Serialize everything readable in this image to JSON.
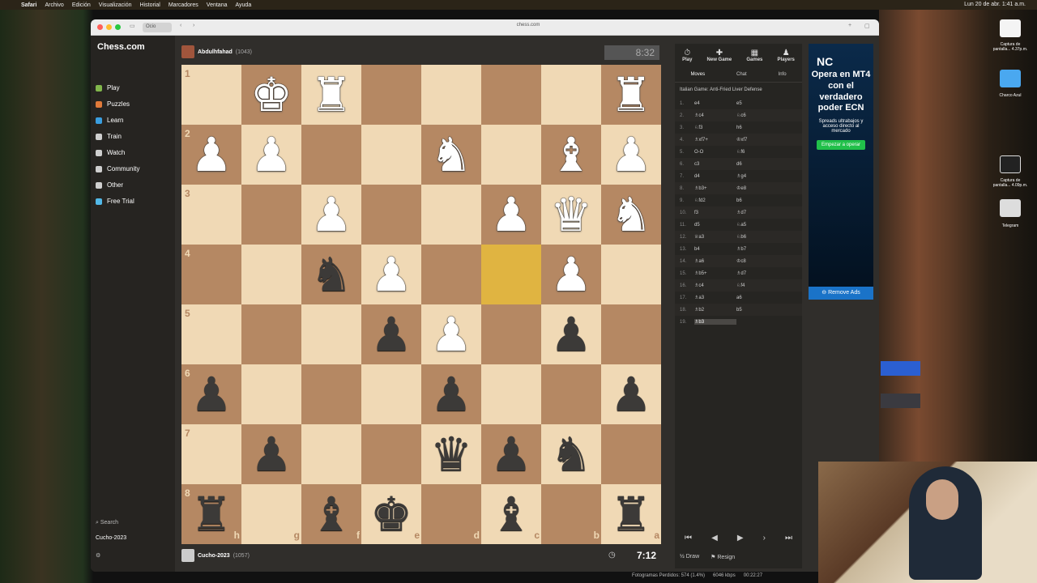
{
  "menubar": {
    "items": [
      "Safari",
      "Archivo",
      "Edición",
      "Visualización",
      "Historial",
      "Marcadores",
      "Ventana",
      "Ayuda"
    ],
    "clock": "Lun 20 de abr. 1:41 a.m."
  },
  "browser": {
    "tab": "Ocio",
    "url": "chess.com"
  },
  "sidebar": {
    "logo": "Chess.com",
    "items": [
      {
        "label": "Play",
        "color": "#81b64c"
      },
      {
        "label": "Puzzles",
        "color": "#e07a3a"
      },
      {
        "label": "Learn",
        "color": "#3a9ee0"
      },
      {
        "label": "Train",
        "color": "#cfcfcf"
      },
      {
        "label": "Watch",
        "color": "#cfcfcf"
      },
      {
        "label": "Community",
        "color": "#cfcfcf"
      },
      {
        "label": "Other",
        "color": "#cfcfcf"
      },
      {
        "label": "Free Trial",
        "color": "#52b8e8"
      }
    ],
    "search": "Search",
    "user": "Cucho-2023"
  },
  "top_player": {
    "name": "Abdulhfahad",
    "rating": "(1043)",
    "clock": "8:32"
  },
  "bottom_player": {
    "name": "Cucho-2023",
    "rating": "(1057)",
    "clock": "7:12"
  },
  "board": {
    "ranks": [
      "1",
      "2",
      "3",
      "4",
      "5",
      "6",
      "7",
      "8"
    ],
    "files": [
      "h",
      "g",
      "f",
      "e",
      "d",
      "c",
      "b",
      "a"
    ],
    "highlight": [
      [
        3,
        5
      ]
    ],
    "pieces": [
      {
        "r": 0,
        "c": 1,
        "p": "♚",
        "side": "w"
      },
      {
        "r": 0,
        "c": 2,
        "p": "♜",
        "side": "w"
      },
      {
        "r": 0,
        "c": 7,
        "p": "♜",
        "side": "w"
      },
      {
        "r": 1,
        "c": 0,
        "p": "♟",
        "side": "w"
      },
      {
        "r": 1,
        "c": 1,
        "p": "♟",
        "side": "w"
      },
      {
        "r": 1,
        "c": 4,
        "p": "♞",
        "side": "w"
      },
      {
        "r": 1,
        "c": 6,
        "p": "♝",
        "side": "w"
      },
      {
        "r": 1,
        "c": 7,
        "p": "♟",
        "side": "w"
      },
      {
        "r": 2,
        "c": 2,
        "p": "♟",
        "side": "w"
      },
      {
        "r": 2,
        "c": 5,
        "p": "♟",
        "side": "w"
      },
      {
        "r": 2,
        "c": 6,
        "p": "♛",
        "side": "w"
      },
      {
        "r": 2,
        "c": 7,
        "p": "♞",
        "side": "w"
      },
      {
        "r": 3,
        "c": 2,
        "p": "♞",
        "side": "b"
      },
      {
        "r": 3,
        "c": 3,
        "p": "♟",
        "side": "w"
      },
      {
        "r": 3,
        "c": 6,
        "p": "♟",
        "side": "w"
      },
      {
        "r": 4,
        "c": 3,
        "p": "♟",
        "side": "b"
      },
      {
        "r": 4,
        "c": 4,
        "p": "♟",
        "side": "w"
      },
      {
        "r": 4,
        "c": 6,
        "p": "♟",
        "side": "b"
      },
      {
        "r": 5,
        "c": 0,
        "p": "♟",
        "side": "b"
      },
      {
        "r": 5,
        "c": 4,
        "p": "♟",
        "side": "b"
      },
      {
        "r": 5,
        "c": 7,
        "p": "♟",
        "side": "b"
      },
      {
        "r": 6,
        "c": 1,
        "p": "♟",
        "side": "b"
      },
      {
        "r": 6,
        "c": 4,
        "p": "♛",
        "side": "b"
      },
      {
        "r": 6,
        "c": 5,
        "p": "♟",
        "side": "b"
      },
      {
        "r": 6,
        "c": 6,
        "p": "♞",
        "side": "b"
      },
      {
        "r": 7,
        "c": 0,
        "p": "♜",
        "side": "b"
      },
      {
        "r": 7,
        "c": 2,
        "p": "♝",
        "side": "b"
      },
      {
        "r": 7,
        "c": 3,
        "p": "♚",
        "side": "b"
      },
      {
        "r": 7,
        "c": 5,
        "p": "♝",
        "side": "b"
      },
      {
        "r": 7,
        "c": 7,
        "p": "♜",
        "side": "b"
      }
    ]
  },
  "panel": {
    "top": [
      "Play",
      "New Game",
      "Games",
      "Players"
    ],
    "tabs": [
      "Moves",
      "Chat",
      "Info"
    ],
    "opening": "Italian Game: Anti-Fried Liver Defense",
    "moves": [
      [
        "1.",
        "e4",
        "e5"
      ],
      [
        "2.",
        "♗c4",
        "♘c6"
      ],
      [
        "3.",
        "♘f3",
        "h6"
      ],
      [
        "4.",
        "♗xf7+",
        "♔xf7"
      ],
      [
        "5.",
        "O-O",
        "♘f6"
      ],
      [
        "6.",
        "c3",
        "d6"
      ],
      [
        "7.",
        "d4",
        "♗g4"
      ],
      [
        "8.",
        "♗b3+",
        "♔e8"
      ],
      [
        "9.",
        "♘fd2",
        "b6"
      ],
      [
        "10.",
        "f3",
        "♗d7"
      ],
      [
        "11.",
        "d5",
        "♘a5"
      ],
      [
        "12.",
        "♕a3",
        "♘b6"
      ],
      [
        "13.",
        "b4",
        "♗b7"
      ],
      [
        "14.",
        "♗a6",
        "♔c8"
      ],
      [
        "15.",
        "♗b5+",
        "♗d7"
      ],
      [
        "16.",
        "♗c4",
        "♘f4"
      ],
      [
        "17.",
        "♗a3",
        "a6"
      ],
      [
        "18.",
        "♗b2",
        "b5"
      ],
      [
        "19.",
        "♗b3",
        ""
      ]
    ],
    "draw": "Draw",
    "resign": "Resign"
  },
  "ad": {
    "brand": "NC",
    "headline": "Opera en MT4 con el verdadero poder ECN",
    "sub": "Spreads ultrabajos y acceso directo al mercado",
    "cta": "Empezar a operar",
    "remove": "Remove Ads"
  },
  "desktop": {
    "icons": [
      "Captura de pantalla... 4.37p.m.",
      "Charco Azul",
      "Captura de pantalla... 4.09p.m.",
      "Telegram"
    ]
  },
  "statusbar": {
    "frames": "Fotogramas Perdidos: 574 (1.4%)",
    "bitrate": "6046 kbps",
    "time": "00:22:27"
  }
}
